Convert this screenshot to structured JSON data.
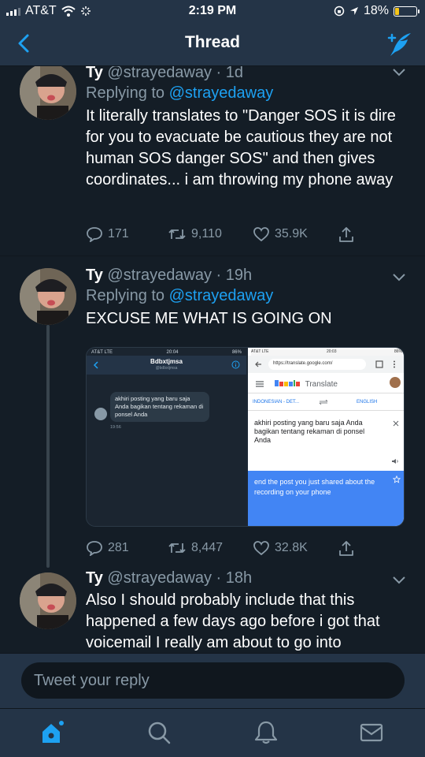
{
  "status_bar": {
    "carrier": "AT&T",
    "time": "2:19 PM",
    "battery": "18%",
    "battery_level": 0.18
  },
  "nav": {
    "title": "Thread"
  },
  "tweets": [
    {
      "name": "Ty",
      "handle": "@strayedaway",
      "time": "1d",
      "replying_prefix": "Replying to",
      "replying_to": "@strayedaway",
      "text": "It literally translates to \"Danger SOS it is dire for you to evacuate be cautious they are not human SOS danger SOS\" and then gives coordinates... i am throwing my phone away",
      "replies": "171",
      "retweets": "9,110",
      "likes": "35.9K"
    },
    {
      "name": "Ty",
      "handle": "@strayedaway",
      "time": "19h",
      "replying_prefix": "Replying to",
      "replying_to": "@strayedaway",
      "text": "EXCUSE ME WHAT IS GOING ON",
      "replies": "281",
      "retweets": "8,447",
      "likes": "32.8K",
      "attachment": {
        "left": {
          "carrier": "AT&T LTE",
          "time": "20:04",
          "battery": "86%",
          "contact_name": "Bdbxtjmsa",
          "contact_sub": "@bdbxtjmsa",
          "message": "akhiri posting yang baru saja Anda bagikan tentang rekaman di ponsel Anda",
          "message_time": "19:56"
        },
        "right": {
          "carrier": "AT&T LTE",
          "time": "20:03",
          "battery": "86%",
          "url": "https://translate.google.com/",
          "app_name": "Translate",
          "source_lang": "INDONESIAN - DET...",
          "target_lang": "ENGLISH",
          "source_text": "akhiri posting yang baru saja Anda bagikan tentang rekaman di ponsel Anda",
          "translated_text": "end the post you just shared about the recording on your phone"
        }
      }
    },
    {
      "name": "Ty",
      "handle": "@strayedaway",
      "time": "18h",
      "text": "Also I should probably include that this happened a few days ago before i got that voicemail I really am about to go into"
    }
  ],
  "reply_input": {
    "placeholder": "Tweet your reply"
  },
  "tabs": [
    "home",
    "search",
    "notifications",
    "messages"
  ],
  "colors": {
    "accent": "#1da1f2",
    "background": "#141d26",
    "bar": "#243447",
    "muted": "#8899a6"
  }
}
